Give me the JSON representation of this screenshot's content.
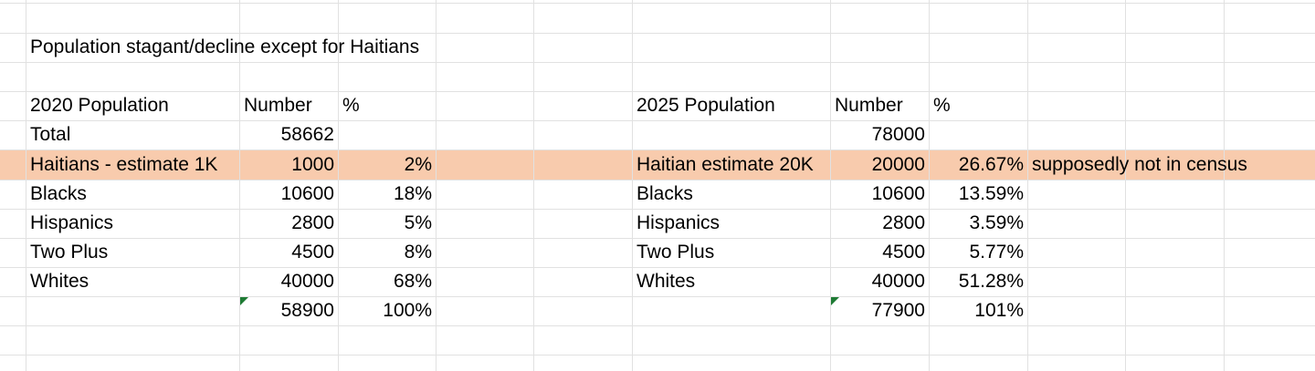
{
  "title": "Population stagant/decline except for Haitians",
  "table_2020": {
    "headers": [
      "2020 Population",
      "Number",
      "%"
    ],
    "rows": [
      {
        "label": "Total",
        "number": "58662",
        "pct": ""
      },
      {
        "label": "Haitians - estimate 1K",
        "number": "1000",
        "pct": "2%"
      },
      {
        "label": "Blacks",
        "number": "10600",
        "pct": "18%"
      },
      {
        "label": "Hispanics",
        "number": "2800",
        "pct": "5%"
      },
      {
        "label": "Two Plus",
        "number": "4500",
        "pct": "8%"
      },
      {
        "label": "Whites",
        "number": "40000",
        "pct": "68%"
      },
      {
        "label": "",
        "number": "58900",
        "pct": "100%"
      }
    ]
  },
  "table_2025": {
    "headers": [
      "2025 Population",
      "Number",
      "%"
    ],
    "rows": [
      {
        "label": "",
        "number": "78000",
        "pct": "",
        "note": ""
      },
      {
        "label": "Haitian estimate 20K",
        "number": "20000",
        "pct": "26.67%",
        "note": "supposedly not in census"
      },
      {
        "label": "Blacks",
        "number": "10600",
        "pct": "13.59%",
        "note": ""
      },
      {
        "label": "Hispanics",
        "number": "2800",
        "pct": "3.59%",
        "note": ""
      },
      {
        "label": "Two Plus",
        "number": "4500",
        "pct": "5.77%",
        "note": ""
      },
      {
        "label": "Whites",
        "number": "40000",
        "pct": "51.28%",
        "note": ""
      },
      {
        "label": "",
        "number": "77900",
        "pct": "101%",
        "note": ""
      }
    ]
  },
  "colors": {
    "highlight_row": "#f8cbad",
    "gridline": "#e1e1e1",
    "error_indicator": "#1e7b34"
  }
}
